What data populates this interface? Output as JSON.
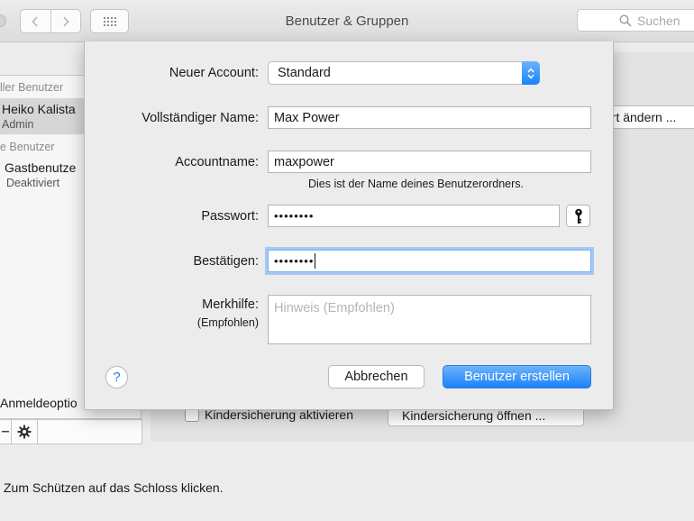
{
  "window": {
    "title": "Benutzer & Gruppen",
    "search_placeholder": "Suchen"
  },
  "sidebar": {
    "section_current": "ller Benutzer",
    "section_other": "e Benutzer",
    "users": [
      {
        "name": "Heiko Kalista",
        "role": "Admin",
        "selected": true
      },
      {
        "name": "Gastbenutze",
        "role": "Deaktiviert",
        "selected": false
      }
    ],
    "login_options": "Anmeldeoptio"
  },
  "background": {
    "change_button": "ort ändern ...",
    "parental_checkbox_label": "Kindersicherung aktivieren",
    "parental_open_button": "Kindersicherung öffnen ...",
    "lock_message": "Zum Schützen auf das Schloss klicken."
  },
  "dialog": {
    "account_type_label": "Neuer Account:",
    "account_type_value": "Standard",
    "fullname_label": "Vollständiger Name:",
    "fullname_value": "Max Power",
    "accountname_label": "Accountname:",
    "accountname_value": "maxpower",
    "accountname_hint": "Dies ist der Name deines Benutzerordners.",
    "password_label": "Passwort:",
    "password_value": "••••••••",
    "confirm_label": "Bestätigen:",
    "confirm_value": "••••••••",
    "hint_label": "Merkhilfe:",
    "hint_sublabel": "(Empfohlen)",
    "hint_placeholder": "Hinweis (Empfohlen)",
    "help_glyph": "?",
    "cancel_label": "Abbrechen",
    "create_label": "Benutzer erstellen"
  },
  "colors": {
    "accent": "#1a82fb",
    "focus_ring": "#a6c8f5"
  }
}
